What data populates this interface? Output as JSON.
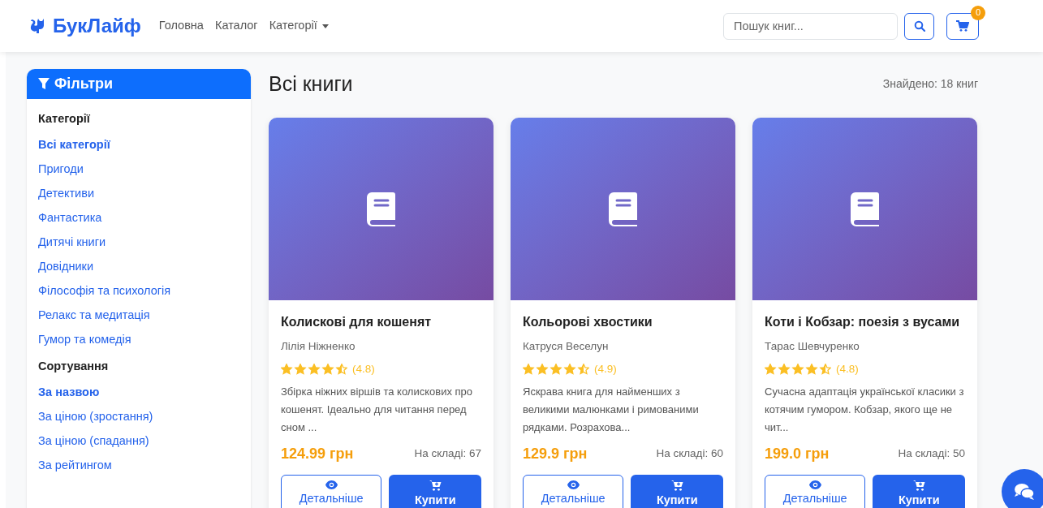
{
  "brand": "БукЛайф",
  "nav": [
    {
      "label": "Головна",
      "dropdown": false
    },
    {
      "label": "Каталог",
      "dropdown": false
    },
    {
      "label": "Категорії",
      "dropdown": true
    }
  ],
  "search": {
    "placeholder": "Пошук книг..."
  },
  "cart": {
    "count": "0"
  },
  "filters": {
    "title": "Фільтри",
    "sections": [
      {
        "heading": "Категорії",
        "items": [
          {
            "label": "Всі категорії",
            "selected": true
          },
          {
            "label": "Пригоди",
            "selected": false
          },
          {
            "label": "Детективи",
            "selected": false
          },
          {
            "label": "Фантастика",
            "selected": false
          },
          {
            "label": "Дитячі книги",
            "selected": false
          },
          {
            "label": "Довідники",
            "selected": false
          },
          {
            "label": "Філософія та психологія",
            "selected": false
          },
          {
            "label": "Релакс та медитація",
            "selected": false
          },
          {
            "label": "Гумор та комедія",
            "selected": false
          }
        ]
      },
      {
        "heading": "Сортування",
        "items": [
          {
            "label": "За назвою",
            "selected": true
          },
          {
            "label": "За ціною (зростання)",
            "selected": false
          },
          {
            "label": "За ціною (спадання)",
            "selected": false
          },
          {
            "label": "За рейтингом",
            "selected": false
          }
        ]
      }
    ]
  },
  "heading": "Всі книги",
  "found": "Знайдено: 18 книг",
  "books": [
    {
      "title": "Колискові для кошенят",
      "author": "Лілія Ніжненко",
      "stars": 4.5,
      "rating": "(4.8)",
      "description": "Збірка ніжних віршів та колискових про кошенят. Ідеально для читання перед сном ...",
      "price": "124.99 грн",
      "stock": "На складі: 67",
      "details": "Детальніше",
      "buy": "Купити"
    },
    {
      "title": "Кольорові хвостики",
      "author": "Катруся Веселун",
      "stars": 4.5,
      "rating": "(4.9)",
      "description": "Яскрава книга для найменших з великими малюнками і римованими рядками. Розрахова...",
      "price": "129.9 грн",
      "stock": "На складі: 60",
      "details": "Детальніше",
      "buy": "Купити"
    },
    {
      "title": "Коти і Кобзар: поезія з вусами",
      "author": "Тарас Шевчуренко",
      "stars": 4.5,
      "rating": "(4.8)",
      "description": "Сучасна адаптація української класики з котячим гумором. Кобзар, якого ще не чит...",
      "price": "199.0 грн",
      "stock": "На складі: 50",
      "details": "Детальніше",
      "buy": "Купити"
    }
  ]
}
